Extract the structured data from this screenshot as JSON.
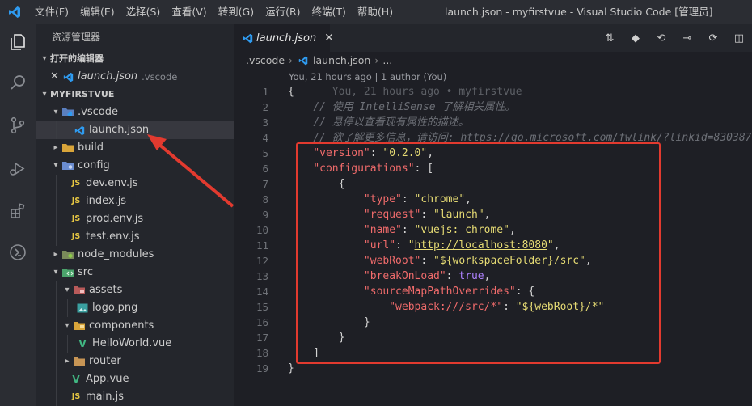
{
  "menu": [
    "文件(F)",
    "编辑(E)",
    "选择(S)",
    "查看(V)",
    "转到(G)",
    "运行(R)",
    "终端(T)",
    "帮助(H)"
  ],
  "window_title": "launch.json - myfirstvue - Visual Studio Code [管理员]",
  "sidebar": {
    "title": "资源管理器",
    "open_editors": {
      "header": "打开的编辑器",
      "file": "launch.json",
      "dir": ".vscode"
    },
    "project": "MYFIRSTVUE",
    "tree": [
      {
        "label": ".vscode",
        "kind": "folder"
      },
      {
        "label": "launch.json",
        "kind": "file"
      },
      {
        "label": "build",
        "kind": "folder"
      },
      {
        "label": "config",
        "kind": "folder"
      },
      {
        "label": "dev.env.js",
        "kind": "js"
      },
      {
        "label": "index.js",
        "kind": "js"
      },
      {
        "label": "prod.env.js",
        "kind": "js"
      },
      {
        "label": "test.env.js",
        "kind": "js"
      },
      {
        "label": "node_modules",
        "kind": "folder"
      },
      {
        "label": "src",
        "kind": "folder"
      },
      {
        "label": "assets",
        "kind": "folder"
      },
      {
        "label": "logo.png",
        "kind": "image"
      },
      {
        "label": "components",
        "kind": "folder"
      },
      {
        "label": "HelloWorld.vue",
        "kind": "vue"
      },
      {
        "label": "router",
        "kind": "folder"
      },
      {
        "label": "App.vue",
        "kind": "vue"
      },
      {
        "label": "main.js",
        "kind": "js"
      }
    ]
  },
  "editor": {
    "tab_label": "launch.json",
    "breadcrumb": [
      ".vscode",
      "launch.json",
      "..."
    ],
    "codelens": "You, 21 hours ago | 1 author (You)",
    "line_numbers": [
      "1",
      "2",
      "3",
      "4",
      "5",
      "6",
      "7",
      "8",
      "9",
      "10",
      "11",
      "12",
      "13",
      "14",
      "15",
      "16",
      "17",
      "18",
      "19"
    ],
    "code": {
      "blame": "You, 21 hours ago • myfirstvue",
      "comment1": "// 使用 IntelliSense 了解相关属性。",
      "comment2": "// 悬停以查看现有属性的描述。",
      "comment3": "// 欲了解更多信息，请访问: https://go.microsoft.com/fwlink/?linkid=830387",
      "version_key": "\"version\"",
      "version_val": "\"0.2.0\"",
      "configurations_key": "\"configurations\"",
      "type_key": "\"type\"",
      "type_val": "\"chrome\"",
      "request_key": "\"request\"",
      "request_val": "\"launch\"",
      "name_key": "\"name\"",
      "name_val": "\"vuejs: chrome\"",
      "url_key": "\"url\"",
      "url_val": "http://localhost:8080",
      "webroot_key": "\"webRoot\"",
      "webroot_val": "\"${workspaceFolder}/src\"",
      "breakonload_key": "\"breakOnLoad\"",
      "breakonload_val": "true",
      "sourcemap_key": "\"sourceMapPathOverrides\"",
      "webpack_key": "\"webpack:///src/*\"",
      "webpack_val": "\"${webRoot}/*\""
    }
  },
  "colors": {
    "highlight_box": "#e23a2f",
    "arrow": "#e23a2f",
    "accent": "#3c9be8"
  }
}
